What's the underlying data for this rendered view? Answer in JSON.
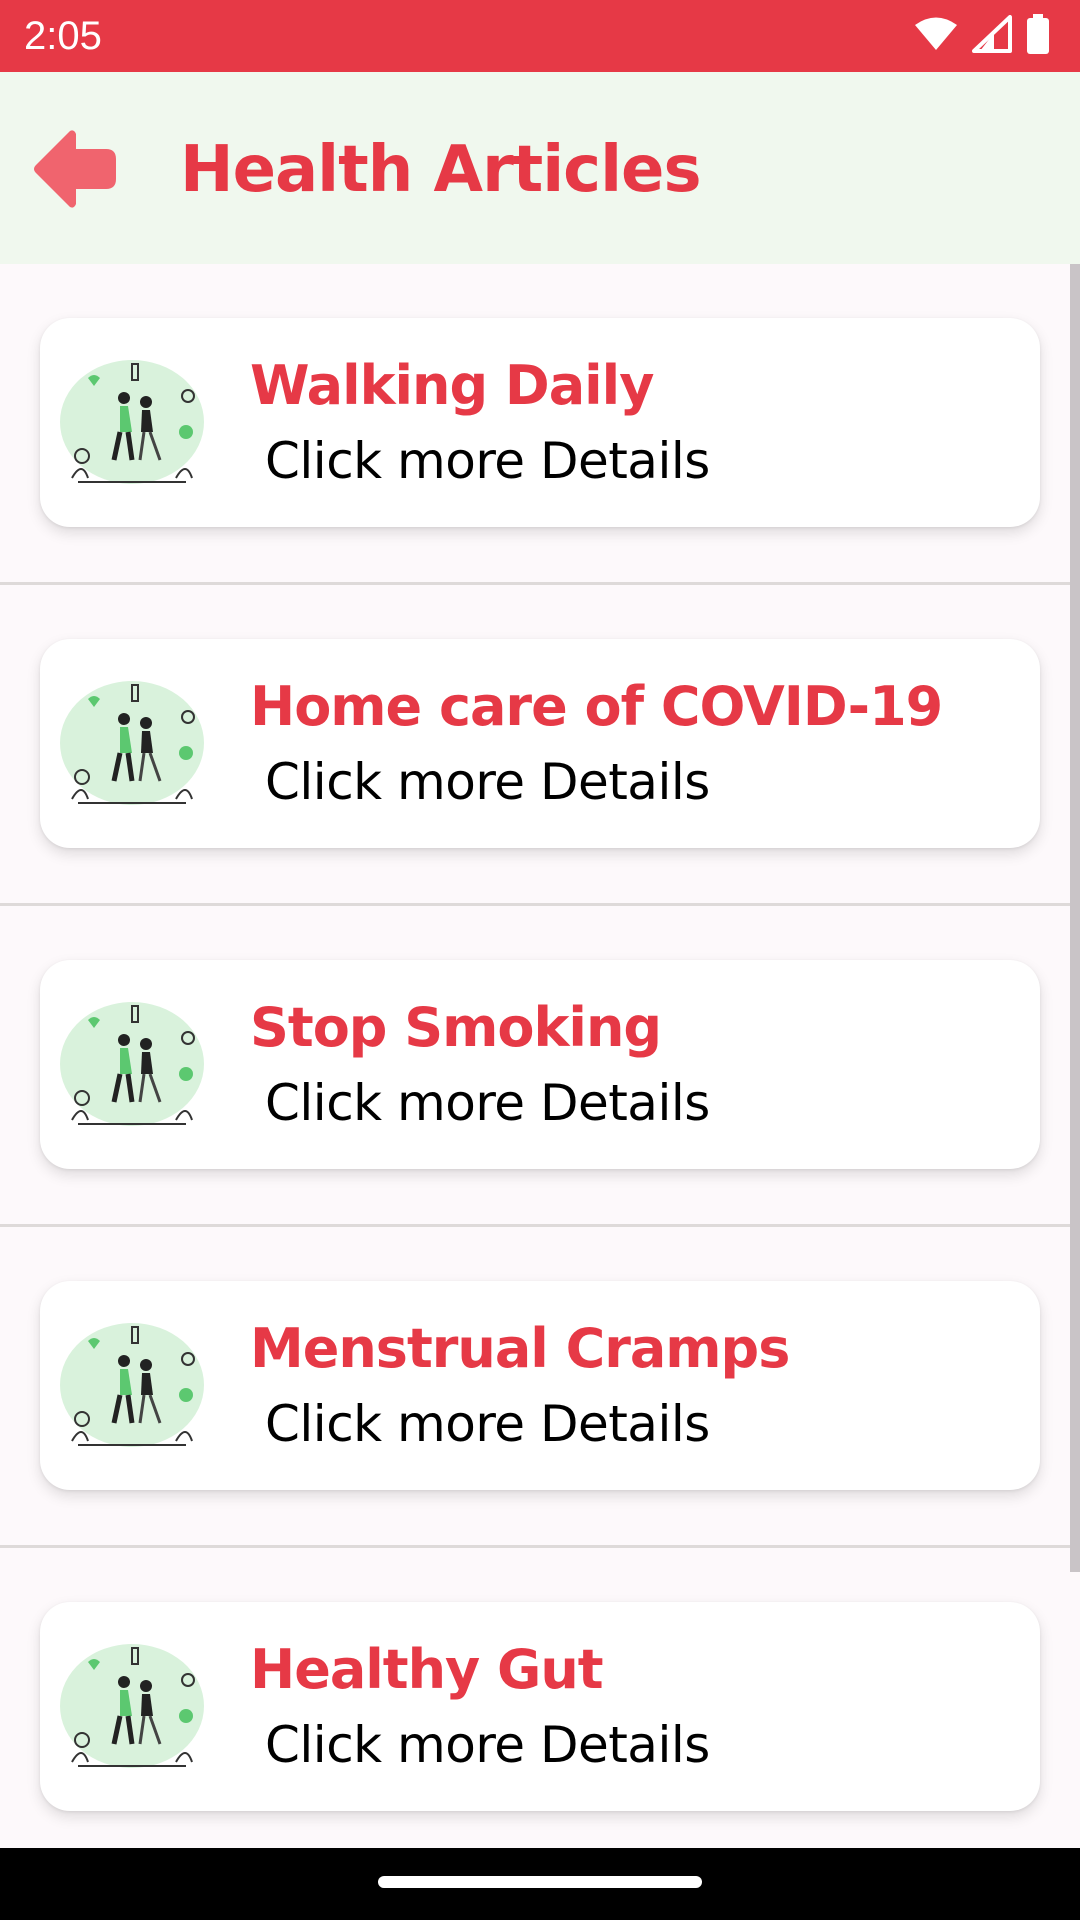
{
  "status_bar": {
    "time": "2:05",
    "icons": [
      "wifi-icon",
      "signal-icon",
      "battery-icon"
    ]
  },
  "app_bar": {
    "title": "Health Articles",
    "back_icon": "back-arrow-icon"
  },
  "articles": [
    {
      "title": "Walking Daily",
      "subtitle": "Click more Details",
      "image": "walking-couple-illustration"
    },
    {
      "title": "Home care of COVID-19",
      "subtitle": "Click more Details",
      "image": "walking-couple-illustration"
    },
    {
      "title": "Stop Smoking",
      "subtitle": "Click more Details",
      "image": "walking-couple-illustration"
    },
    {
      "title": "Menstrual Cramps",
      "subtitle": "Click more Details",
      "image": "walking-couple-illustration"
    },
    {
      "title": "Healthy Gut",
      "subtitle": "Click more Details",
      "image": "walking-couple-illustration"
    }
  ],
  "colors": {
    "accent": "#e63946",
    "app_bar_bg": "#f0f8ee",
    "page_bg": "#fdf9fb",
    "card_bg": "#ffffff",
    "illustration_blob": "#d9f2dc",
    "illustration_green": "#5cc870"
  }
}
